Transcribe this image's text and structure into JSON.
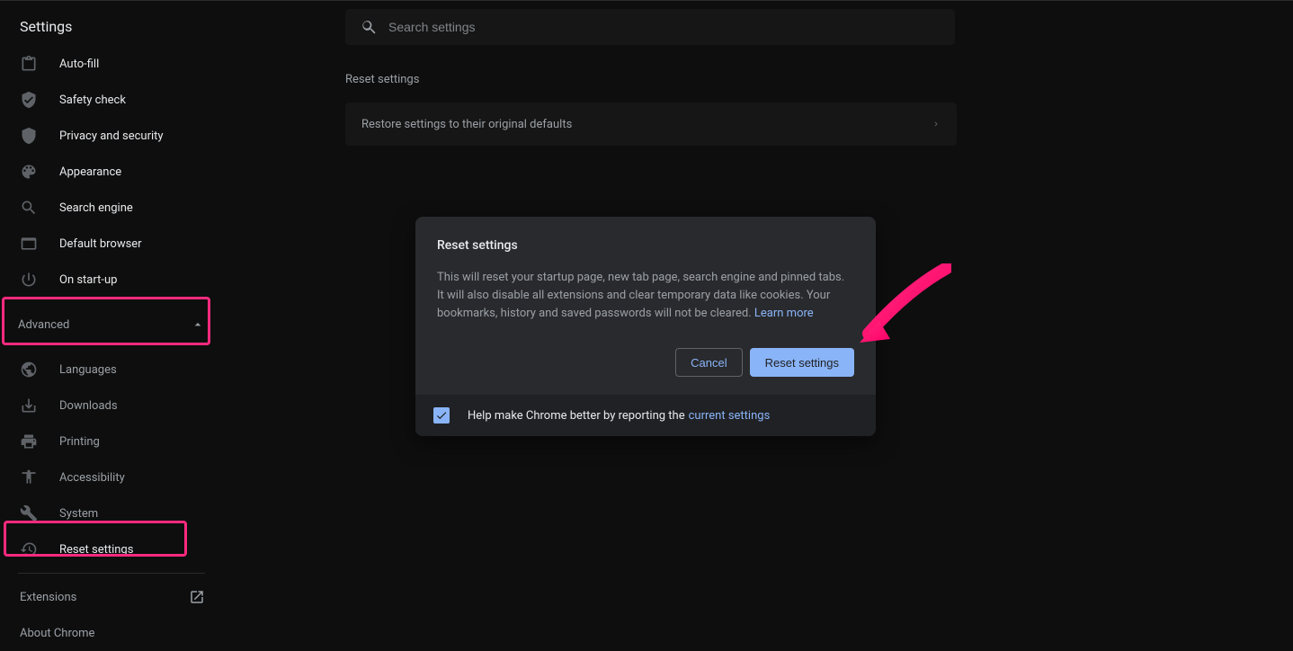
{
  "header": {
    "title": "Settings"
  },
  "search": {
    "placeholder": "Search settings"
  },
  "sidebar": {
    "items": [
      {
        "label": "Auto-fill"
      },
      {
        "label": "Safety check"
      },
      {
        "label": "Privacy and security"
      },
      {
        "label": "Appearance"
      },
      {
        "label": "Search engine"
      },
      {
        "label": "Default browser"
      },
      {
        "label": "On start-up"
      }
    ],
    "advanced_label": "Advanced",
    "advanced_items": [
      {
        "label": "Languages"
      },
      {
        "label": "Downloads"
      },
      {
        "label": "Printing"
      },
      {
        "label": "Accessibility"
      },
      {
        "label": "System"
      },
      {
        "label": "Reset settings"
      }
    ],
    "footer": [
      {
        "label": "Extensions"
      },
      {
        "label": "About Chrome"
      }
    ]
  },
  "main": {
    "section_title": "Reset settings",
    "row_label": "Restore settings to their original defaults"
  },
  "dialog": {
    "title": "Reset settings",
    "body": "This will reset your startup page, new tab page, search engine and pinned tabs. It will also disable all extensions and clear temporary data like cookies. Your bookmarks, history and saved passwords will not be cleared.",
    "learn_more": "Learn more",
    "cancel": "Cancel",
    "confirm": "Reset settings",
    "footer_text": "Help make Chrome better by reporting the",
    "footer_link": "current settings"
  },
  "annotation": {
    "arrow_color": "#ff2a7f"
  }
}
